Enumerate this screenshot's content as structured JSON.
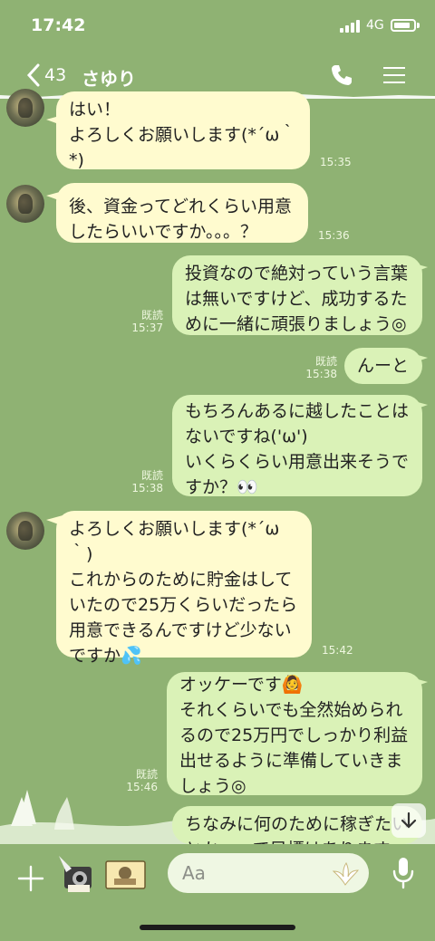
{
  "status_bar": {
    "time": "17:42",
    "network": "4G"
  },
  "header": {
    "back_count": "43",
    "chat_name": "さゆり",
    "call_icon": "phone-icon",
    "menu_icon": "hamburger-menu-icon"
  },
  "messages": [
    {
      "sender": "contact",
      "text": "はい！\nよろしくお願いします(*´ω｀\n*)",
      "time": "15:35"
    },
    {
      "sender": "contact",
      "text": "後、資金ってどれくらい用意\nしたらいいですか。。。？",
      "time": "15:36"
    },
    {
      "sender": "me",
      "text": "投資なので絶対っていう言葉\nは無いですけど、成功するた\nめに一緒に頑張りましょう◎",
      "read": "既読",
      "time": "15:37"
    },
    {
      "sender": "me",
      "text": "んーと",
      "read": "既読",
      "time": "15:38"
    },
    {
      "sender": "me",
      "text": "もちろんあるに越したことは\nないですね('ω')\nいくらくらい用意出来そうで\nすか？👀",
      "read": "既読",
      "time": "15:38"
    },
    {
      "sender": "contact",
      "text": "よろしくお願いします(*´ω\n｀)\nこれからのために貯金はして\nいたので25万くらいだったら\n用意できるんですけど少ない\nですか💦",
      "time": "15:42"
    },
    {
      "sender": "me",
      "text": "オッケーです🙆\nそれくらいでも全然始められ\nるので25万円でしっかり利益\n出せるように準備していきま\nしょう◎",
      "read": "既読",
      "time": "15:46"
    },
    {
      "sender": "me",
      "text": "ちなみに何のために稼ぎたい\nとか、って目標はありますか？",
      "partial": true
    }
  ],
  "composer": {
    "placeholder": "Aa",
    "plus_icon": "plus-icon",
    "camera_icon": "camera-sticker-icon",
    "gallery_icon": "photo-sticker-icon",
    "emoji_icon": "flower-emoji-icon",
    "mic_icon": "microphone-icon"
  },
  "colors": {
    "background": "#8fb273",
    "incoming_bubble": "#fffbcf",
    "outgoing_bubble": "#daf2b7",
    "header_text": "#ffffff"
  }
}
